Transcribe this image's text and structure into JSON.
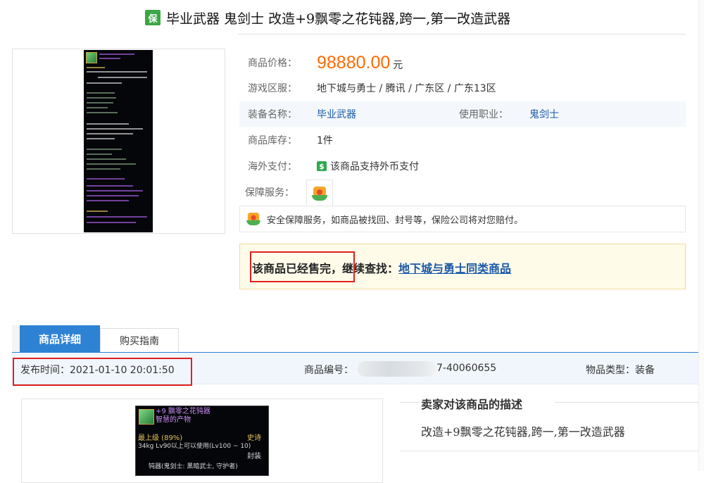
{
  "title": {
    "badge": "保",
    "text": "毕业武器 鬼剑士 改造+9飘零之花钝器,跨一,第一改造武器"
  },
  "thumbnail": {
    "card_title": "+9 飘零之花钝器",
    "card_subtitle": "智慧的产物"
  },
  "info": {
    "price_label": "商品价格：",
    "price_value": "98880.00",
    "price_unit": "元",
    "server_label": "游戏区服：",
    "server_value": "地下城与勇士 / 腾讯 / 广东区 / 广东13区",
    "equip_label": "装备名称：",
    "equip_value": "毕业武器",
    "job_label": "使用职业：",
    "job_value": "鬼剑士",
    "stock_label": "商品库存：",
    "stock_value": "1件",
    "overseas_label": "海外支付：",
    "overseas_icon": "$",
    "overseas_value": "该商品支持外币支付",
    "guard_label": "保障服务：",
    "guard_desc": "安全保障服务，如商品被找回、封号等，保险公司将对您赔付。"
  },
  "notice": {
    "sold_text": "该商品已经售完，",
    "continue_text": "继续查找：",
    "link_text": "地下城与勇士同类商品"
  },
  "tabs": {
    "detail": "商品详细",
    "guide": "购买指南"
  },
  "meta": {
    "publish_time": "发布时间：2021-01-10 20:01:50",
    "item_no_label": "商品编号：",
    "item_no_suffix": "7-40060655",
    "item_type": "物品类型：装备"
  },
  "detail_card": {
    "line1": "+9 飘零之花钝器",
    "line2": "智慧的产物",
    "line3a": "最上级 (89%)",
    "line3b": "史诗",
    "line4": "34kg  Lv90以上可以使用(Lv100 ~ 10)",
    "line5": "封装",
    "line6": "钝器(鬼剑士: 黑暗武士, 守护者)"
  },
  "description": {
    "title": "卖家对该商品的描述",
    "body": "改造+9飘零之花钝器,跨一,第一改造武器"
  },
  "colors": {
    "accent": "#2e82d4",
    "price": "#ff6a00",
    "link": "#1a58a8",
    "highlight": "#e02020",
    "badge": "#39a845"
  }
}
